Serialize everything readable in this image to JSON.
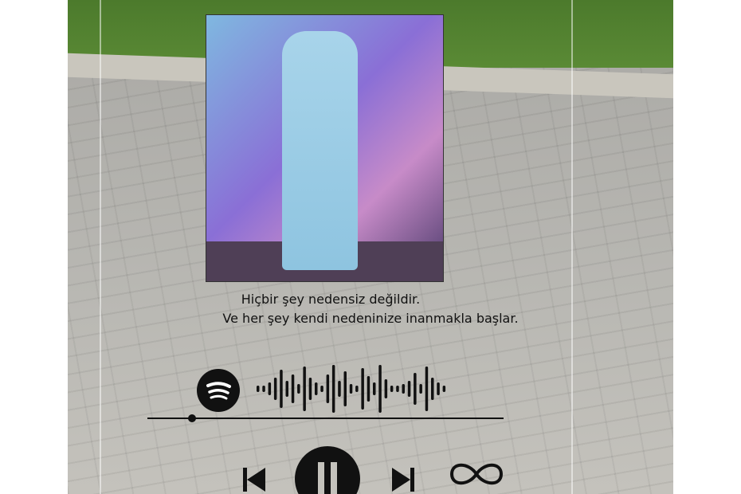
{
  "lyrics": [
    "Hiçbir şey nedensiz değildir.",
    "Ve her şey kendi nedeninize inanmakla başlar."
  ],
  "icons": [
    "spotify-logo-icon",
    "soundwave-code-icon",
    "previous-icon",
    "pause-icon",
    "next-icon",
    "infinity-icon"
  ],
  "progress": 0.13,
  "colors": {
    "ink": "#111111"
  }
}
